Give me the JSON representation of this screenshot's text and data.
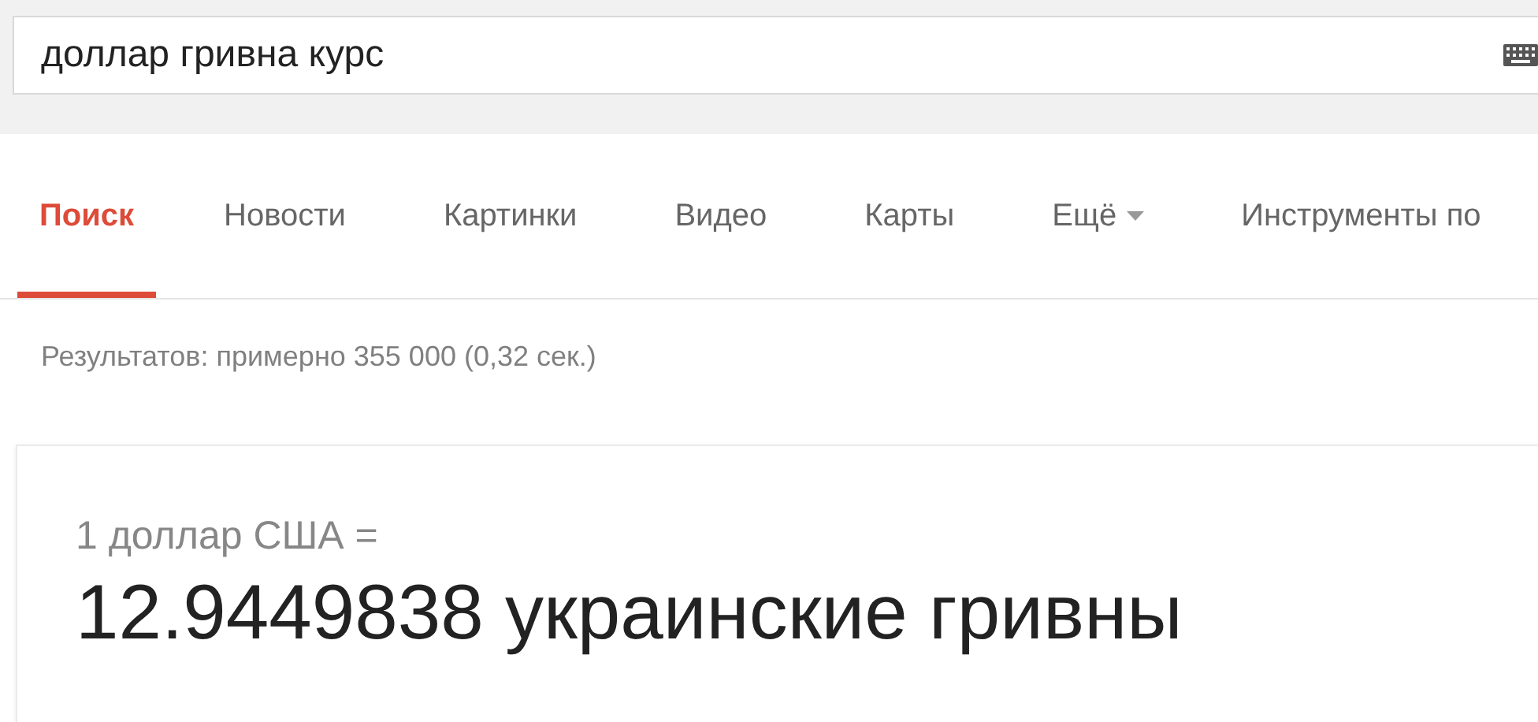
{
  "search": {
    "value": "доллар гривна курс"
  },
  "tabs": [
    {
      "label": "Поиск",
      "selected": true,
      "kind": "tab"
    },
    {
      "label": "Новости",
      "selected": false,
      "kind": "tab"
    },
    {
      "label": "Картинки",
      "selected": false,
      "kind": "tab"
    },
    {
      "label": "Видео",
      "selected": false,
      "kind": "tab"
    },
    {
      "label": "Карты",
      "selected": false,
      "kind": "tab"
    },
    {
      "label": "Ещё",
      "selected": false,
      "kind": "menu"
    },
    {
      "label": "Инструменты по",
      "selected": false,
      "kind": "tab"
    }
  ],
  "result_stats": "Результатов: примерно 355 000 (0,32 сек.)",
  "converter": {
    "from": "1 доллар США =",
    "result": "12.9449838 украинские гривны"
  }
}
